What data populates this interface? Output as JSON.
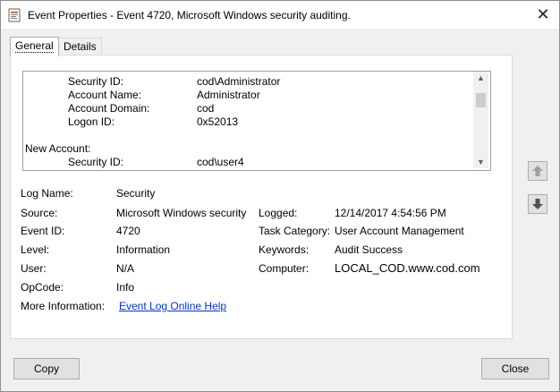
{
  "window": {
    "title": "Event Properties - Event 4720, Microsoft Windows security auditing.",
    "close_symbol": "✕"
  },
  "tabs": [
    {
      "label": "General",
      "active": true
    },
    {
      "label": "Details",
      "active": false
    }
  ],
  "description_lines": [
    {
      "label": "Security ID:",
      "value": "cod\\Administrator"
    },
    {
      "label": "Account Name:",
      "value": "Administrator"
    },
    {
      "label": "Account Domain:",
      "value": "cod"
    },
    {
      "label": "Logon ID:",
      "value": "0x52013"
    },
    {
      "section": "New Account:"
    },
    {
      "label": "Security ID:",
      "value": "cod\\user4"
    }
  ],
  "fields": {
    "log_name": {
      "label": "Log Name:",
      "value": "Security"
    },
    "source": {
      "label": "Source:",
      "value": "Microsoft Windows security"
    },
    "logged": {
      "label": "Logged:",
      "value": "12/14/2017 4:54:56 PM"
    },
    "event_id": {
      "label": "Event ID:",
      "value": "4720"
    },
    "task_category": {
      "label": "Task Category:",
      "value": "User Account Management"
    },
    "level": {
      "label": "Level:",
      "value": "Information"
    },
    "keywords": {
      "label": "Keywords:",
      "value": "Audit Success"
    },
    "user": {
      "label": "User:",
      "value": "N/A"
    },
    "computer": {
      "label": "Computer:",
      "value": "LOCAL_COD.www.cod.com"
    },
    "opcode": {
      "label": "OpCode:",
      "value": "Info"
    },
    "more_info": {
      "label": "More Information:",
      "link_text": "Event Log Online Help"
    }
  },
  "buttons": {
    "copy": "Copy",
    "close": "Close"
  },
  "icons": {
    "title_icon": "event-viewer-icon",
    "up": "arrow-up-icon",
    "down": "arrow-down-icon"
  }
}
